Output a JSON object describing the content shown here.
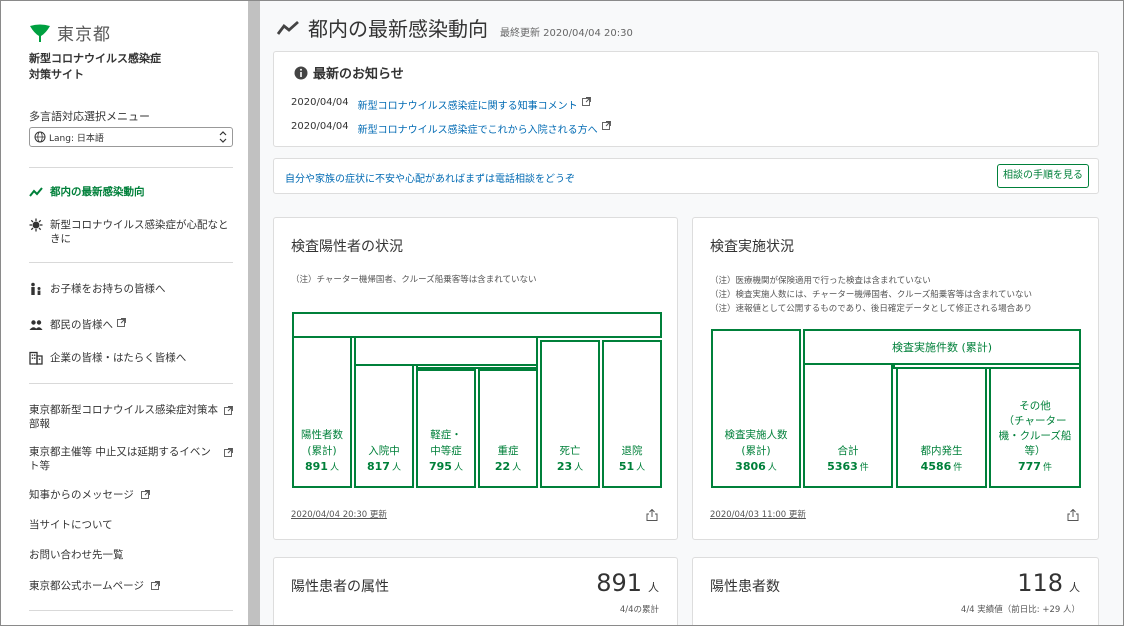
{
  "brand": {
    "logo_text": "東京都",
    "site_title_line1": "新型コロナウイルス感染症",
    "site_title_line2": "対策サイト",
    "brand_color": "#00803a"
  },
  "language": {
    "menu_label": "多言語対応選択メニュー",
    "selected": "Lang: 日本語"
  },
  "sidebar": {
    "nav_primary": [
      {
        "label": "都内の最新感染動向",
        "icon": "trend-chart-icon"
      },
      {
        "label": "新型コロナウイルス感染症が心配なときに",
        "icon": "virus-icon"
      }
    ],
    "nav_audience": [
      {
        "label": "お子様をお持ちの皆様へ",
        "icon": "parent-child-icon"
      },
      {
        "label": "都民の皆様へ",
        "icon": "people-icon"
      },
      {
        "label": "企業の皆様・はたらく皆様へ",
        "icon": "building-icon"
      }
    ],
    "links": [
      {
        "label": "東京都新型コロナウイルス感染症対策本部報"
      },
      {
        "label": "東京都主催等 中止又は延期するイベント等"
      },
      {
        "label": "知事からのメッセージ"
      },
      {
        "label": "当サイトについて"
      },
      {
        "label": "お問い合わせ先一覧"
      },
      {
        "label": "東京都公式ホームページ"
      }
    ]
  },
  "header": {
    "title": "都内の最新感染動向",
    "updated": "最終更新 2020/04/04 20:30"
  },
  "news": {
    "heading": "最新のお知らせ",
    "items": [
      {
        "date": "2020/04/04",
        "text": "新型コロナウイルス感染症に関する知事コメント"
      },
      {
        "date": "2020/04/04",
        "text": "新型コロナウイルス感染症でこれから入院される方へ"
      }
    ]
  },
  "consult": {
    "text": "自分や家族の症状に不安や心配があればまずは電話相談をどうぞ",
    "button": "相談の手順を見る"
  },
  "positive_status": {
    "title": "検査陽性者の状況",
    "note": "（注）チャーター機帰国者、クルーズ船乗客等は含まれていない",
    "cells": [
      {
        "l1": "陽性者数",
        "l2": "(累計)",
        "value": "891",
        "unit": "人"
      },
      {
        "l1": "入院中",
        "l2": "",
        "value": "817",
        "unit": "人"
      },
      {
        "l1": "軽症・",
        "l2": "中等症",
        "value": "795",
        "unit": "人"
      },
      {
        "l1": "重症",
        "l2": "",
        "value": "22",
        "unit": "人"
      },
      {
        "l1": "死亡",
        "l2": "",
        "value": "23",
        "unit": "人"
      },
      {
        "l1": "退院",
        "l2": "",
        "value": "51",
        "unit": "人"
      }
    ],
    "footer": "2020/04/04 20:30 更新"
  },
  "test_status": {
    "title": "検査実施状況",
    "notes": [
      "（注）医療機関が保険適用で行った検査は含まれていない",
      "（注）検査実施人数には、チャーター機帰国者、クルーズ船乗客等は含まれていない",
      "（注）速報値として公開するものであり、後日確定データとして修正される場合あり"
    ],
    "bar_label": "検査実施件数 (累計)",
    "cells": [
      {
        "l1": "検査実施人数",
        "l2": "(累計)",
        "l3": "",
        "l4": "",
        "value": "3806",
        "unit": "人"
      },
      {
        "l1": "合計",
        "l2": "",
        "l3": "",
        "l4": "",
        "value": "5363",
        "unit": "件"
      },
      {
        "l1": "都内発生",
        "l2": "",
        "l3": "",
        "l4": "",
        "value": "4586",
        "unit": "件"
      },
      {
        "l1": "その他",
        "l2": "（チャーター",
        "l3": "機・クルーズ船",
        "l4": "等）",
        "value": "777",
        "unit": "件"
      }
    ],
    "footer": "2020/04/03 11:00 更新"
  },
  "attributes": {
    "title": "陽性患者の属性",
    "value": "891",
    "unit": "人",
    "sub": "4/4の累計"
  },
  "patients": {
    "title": "陽性患者数",
    "value": "118",
    "unit": "人",
    "sub": "4/4 実績値（前日比: +29 人）"
  }
}
